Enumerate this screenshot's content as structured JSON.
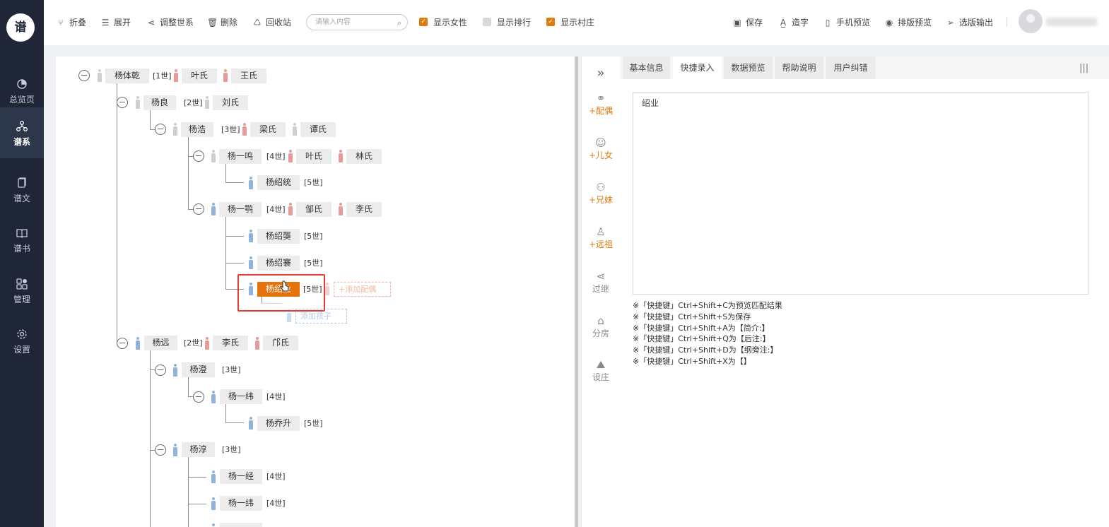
{
  "app": {
    "logo_text": "谱",
    "accent": "#e07a10",
    "sidebar_bg": "#1e2637"
  },
  "sidebar": {
    "items": [
      {
        "label": "总览页",
        "icon": "pie-chart-icon"
      },
      {
        "label": "谱系",
        "icon": "tree-icon",
        "active": true
      },
      {
        "label": "谱文",
        "icon": "document-icon"
      },
      {
        "label": "谱书",
        "icon": "book-icon"
      },
      {
        "label": "管理",
        "icon": "grid-icon"
      },
      {
        "label": "设置",
        "icon": "gear-icon"
      }
    ]
  },
  "toolbar": {
    "collapse": "折叠",
    "expand": "展开",
    "adjust": "调整世系",
    "delete": "删除",
    "recycle": "回收站",
    "search_placeholder": "请输入内容",
    "show_female": "显示女性",
    "show_rank": "显示排行",
    "show_village": "显示村庄",
    "show_female_checked": true,
    "show_rank_checked": false,
    "show_village_checked": true,
    "save": "保存",
    "make_char": "造字",
    "mobile_preview": "手机预览",
    "layout_preview": "排版预览",
    "select_output": "选版输出"
  },
  "tree": {
    "n1": {
      "name": "杨体乾",
      "gen": "[1世]",
      "spouses": [
        "叶氏",
        "王氏"
      ]
    },
    "n2": {
      "name": "杨良",
      "gen": "[2世]",
      "spouses": [
        "刘氏"
      ]
    },
    "n3": {
      "name": "杨浩",
      "gen": "[3世]",
      "spouses": [
        "梁氏",
        "谭氏"
      ]
    },
    "n4": {
      "name": "杨一鸣",
      "gen": "[4世]",
      "spouses": [
        "叶氏",
        "林氏"
      ]
    },
    "n5": {
      "name": "杨绍统",
      "gen": "[5世]"
    },
    "n6": {
      "name": "杨一鹗",
      "gen": "[4世]",
      "spouses": [
        "邹氏",
        "李氏"
      ]
    },
    "n7": {
      "name": "杨绍龑",
      "gen": "[5世]"
    },
    "n8": {
      "name": "杨绍褰",
      "gen": "[5世]"
    },
    "n9": {
      "name": "杨绍业",
      "gen": "[5世]",
      "selected": true
    },
    "add_spouse": "+添加配偶",
    "add_child": "添加孩子",
    "n10": {
      "name": "杨远",
      "gen": "[2世]",
      "spouses": [
        "李氏",
        "邝氏"
      ]
    },
    "n11": {
      "name": "杨澄",
      "gen": "[3世]"
    },
    "n12": {
      "name": "杨一纬",
      "gen": "[4世]"
    },
    "n13": {
      "name": "杨乔升",
      "gen": "[5世]"
    },
    "n14": {
      "name": "杨淳",
      "gen": "[3世]"
    },
    "n15": {
      "name": "杨一经",
      "gen": "[4世]"
    },
    "n16": {
      "name": "杨一纬",
      "gen": "[4世]"
    }
  },
  "tools": {
    "collapse_arrow": "»",
    "spouse": "+配偶",
    "children": "+儿女",
    "siblings": "+兄妹",
    "ancestor": "+远祖",
    "adopt": "过继",
    "branch": "分房",
    "village": "设庄"
  },
  "right": {
    "tabs": [
      "基本信息",
      "快捷录入",
      "数据预览",
      "帮助说明",
      "用户纠错"
    ],
    "active_tab": 1,
    "quick_input": "绍业",
    "hints": [
      "※「快捷键」Ctrl+Shift+C为预览匹配结果",
      "※「快捷键」Ctrl+Shift+S为保存",
      "※「快捷键」Ctrl+Shift+A为【简介:】",
      "※「快捷键」Ctrl+Shift+Q为【后注:】",
      "※「快捷键」Ctrl+Shift+D为【纲旁注:】",
      "※「快捷键」Ctrl+Shift+X为【】"
    ]
  }
}
